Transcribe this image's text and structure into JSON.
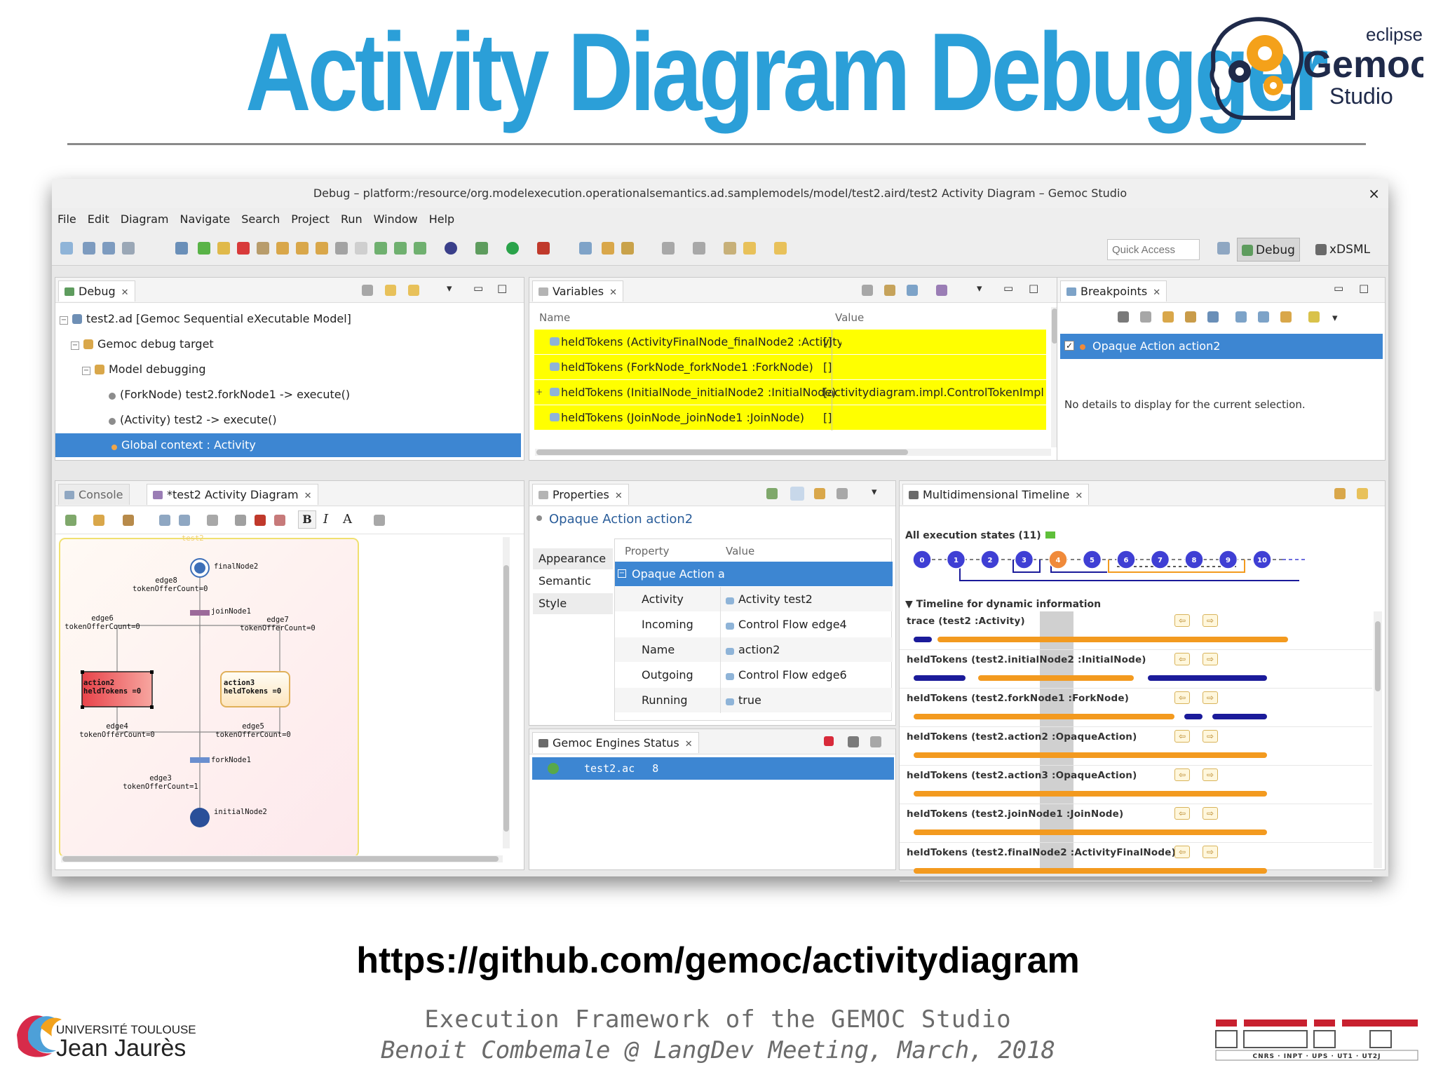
{
  "slide": {
    "title": "Activity Diagram Debugger",
    "logo": {
      "eclipse": "eclipse",
      "gemoc": "Gemoc",
      "studio": "Studio"
    },
    "url": "https://github.com/gemoc/activitydiagram",
    "subtitle": "Execution Framework of the GEMOC Studio",
    "author_line": "Benoit Combemale @ LangDev Meeting, March, 2018",
    "univ_logo": {
      "line1": "UNIVERSITÉ TOULOUSE",
      "line2": "Jean Jaurès"
    },
    "irit_logo": {
      "text": "IRIT",
      "sub": "CNRS · INPT · UPS · UT1 · UT2J"
    }
  },
  "window": {
    "title": "Debug – platform:/resource/org.modelexecution.operationalsemantics.ad.samplemodels/model/test2.aird/test2 Activity Diagram – Gemoc Studio",
    "close": "×",
    "menu": [
      "File",
      "Edit",
      "Diagram",
      "Navigate",
      "Search",
      "Project",
      "Run",
      "Window",
      "Help"
    ],
    "quick_access_placeholder": "Quick Access",
    "perspectives": [
      "Debug",
      "xDSML"
    ]
  },
  "debug_view": {
    "tab": "Debug",
    "tree": [
      "test2.ad [Gemoc Sequential eXecutable Model]",
      "Gemoc debug target",
      "Model debugging",
      "(ForkNode) test2.forkNode1 -> execute()",
      "(Activity) test2 -> execute()",
      "Global context : Activity"
    ]
  },
  "variables_view": {
    "tab": "Variables",
    "columns": [
      "Name",
      "Value"
    ],
    "rows": [
      {
        "name": "heldTokens (ActivityFinalNode_finalNode2 :ActivityFinalNode)",
        "value": "[]"
      },
      {
        "name": "heldTokens (ForkNode_forkNode1 :ForkNode)",
        "value": "[]"
      },
      {
        "name": "heldTokens (InitialNode_initialNode2 :InitialNode)",
        "value": "[activitydiagram.impl.ControlTokenImpl"
      },
      {
        "name": "heldTokens (JoinNode_joinNode1 :JoinNode)",
        "value": "[]"
      }
    ]
  },
  "breakpoints_view": {
    "tab": "Breakpoints",
    "item": "Opaque Action action2",
    "details": "No details to display for the current selection."
  },
  "editor": {
    "tab_console": "Console",
    "tab_diagram": "*test2 Activity Diagram",
    "format_b": "B",
    "format_i": "I",
    "format_a": "A",
    "diagram": {
      "container": "test2",
      "finalNode": "finalNode2",
      "edge8": "edge8",
      "edge8_count": "tokenOfferCount=0",
      "joinNode": "joinNode1",
      "edge6": "edge6",
      "edge6_count": "tokenOfferCount=0",
      "edge7": "edge7",
      "edge7_count": "tokenOfferCount=0",
      "action2": "action2",
      "action2_tokens": "heldTokens =0",
      "action3": "action3",
      "action3_tokens": "heldTokens =0",
      "edge4": "edge4",
      "edge4_count": "tokenOfferCount=0",
      "edge5": "edge5",
      "edge5_count": "tokenOfferCount=0",
      "forkNode": "forkNode1",
      "edge3": "edge3",
      "edge3_count": "tokenOfferCount=1",
      "initialNode": "initialNode2"
    }
  },
  "properties_view": {
    "tab": "Properties",
    "heading": "Opaque Action action2",
    "side_tabs": [
      "Appearance",
      "Semantic",
      "Style"
    ],
    "columns": [
      "Property",
      "Value"
    ],
    "group": "Opaque Action a",
    "rows": [
      {
        "key": "Activity",
        "value": "Activity test2"
      },
      {
        "key": "Incoming",
        "value": "Control Flow edge4"
      },
      {
        "key": "Name",
        "value": "action2"
      },
      {
        "key": "Outgoing",
        "value": "Control Flow edge6"
      },
      {
        "key": "Running",
        "value": "true"
      }
    ]
  },
  "engines_view": {
    "tab": "Gemoc Engines Status",
    "row": "test2.ac",
    "row_count": "8"
  },
  "timeline_view": {
    "tab": "Multidimensional Timeline",
    "states_label": "All execution states (11)",
    "states": [
      "0",
      "1",
      "2",
      "3",
      "4",
      "5",
      "6",
      "7",
      "8",
      "9",
      "10"
    ],
    "current_state": "4",
    "dynamic_label": "Timeline for dynamic information",
    "rows": [
      "trace (test2 :Activity)",
      "heldTokens (test2.initialNode2 :InitialNode)",
      "heldTokens (test2.forkNode1 :ForkNode)",
      "heldTokens (test2.action2 :OpaqueAction)",
      "heldTokens (test2.action3 :OpaqueAction)",
      "heldTokens (test2.joinNode1 :JoinNode)",
      "heldTokens (test2.finalNode2 :ActivityFinalNode)"
    ],
    "colors": {
      "state": "#3f3fd4",
      "current": "#f08a3a",
      "trace_dark": "#1b1b9a",
      "trace_orange": "#f39a1f"
    }
  }
}
